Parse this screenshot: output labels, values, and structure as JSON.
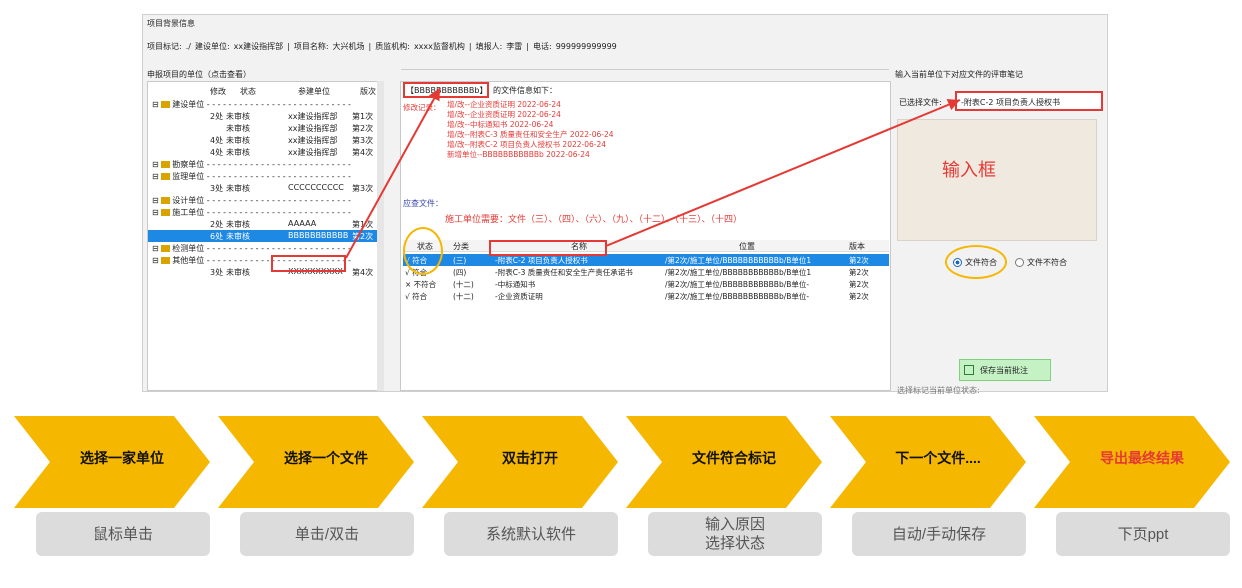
{
  "header": {
    "title": "项目背景信息",
    "info": [
      "项目标记:",
      "./",
      "建设单位:",
      "xx建设指挥部",
      "|",
      "项目名称:",
      "大兴机场",
      "|",
      "质监机构:",
      "xxxx监督机构",
      "|",
      "填报人:",
      "李雷",
      "|",
      "电话:",
      "999999999999"
    ]
  },
  "left_panel": {
    "title": "申报项目的单位（点击查看）",
    "columns": [
      "修改",
      "状态",
      "参建单位",
      "版次"
    ],
    "rows": [
      {
        "type": "group",
        "label": "建设单位"
      },
      {
        "count": "2处",
        "status": "未审核",
        "unit": "xx建设指挥部",
        "ver": "第1次"
      },
      {
        "count": "",
        "status": "未审核",
        "unit": "xx建设指挥部",
        "ver": "第2次"
      },
      {
        "count": "4处",
        "status": "未审核",
        "unit": "xx建设指挥部",
        "ver": "第3次"
      },
      {
        "count": "4处",
        "status": "未审核",
        "unit": "xx建设指挥部",
        "ver": "第4次"
      },
      {
        "type": "group",
        "label": "勘察单位"
      },
      {
        "type": "group",
        "label": "监理单位"
      },
      {
        "count": "3处",
        "status": "未审核",
        "unit": "CCCCCCCCCC",
        "ver": "第3次"
      },
      {
        "type": "group",
        "label": "设计单位"
      },
      {
        "type": "group",
        "label": "施工单位"
      },
      {
        "count": "2处",
        "status": "未审核",
        "unit": "AAAAA",
        "ver": "第1次"
      },
      {
        "count": "6处",
        "status": "未审核",
        "unit": "BBBBBBBBBBB",
        "ver": "第2次",
        "selected": true
      },
      {
        "type": "group",
        "label": "检测单位"
      },
      {
        "type": "group",
        "label": "其他单位"
      },
      {
        "count": "3处",
        "status": "未审核",
        "unit": "XXXXXXXXXX",
        "ver": "第4次"
      }
    ]
  },
  "mid_panel": {
    "unit_tag": "【BBBBBBBBBBBb】",
    "title_suffix": "的文件信息如下：",
    "log_label": "修改记录：",
    "log": [
      "增/改--企业资质证明   2022-06-24",
      "增/改--企业资质证明   2022-06-24",
      "增/改--中标通知书   2022-06-24",
      "增/改--附表C-3 质量责任和安全生产   2022-06-24",
      "增/改--附表C-2 项目负责人授权书   2022-06-24",
      "新增单位--BBBBBBBBBBBb   2022-06-24"
    ],
    "req_label": "应查文件：",
    "req_text": "施工单位需要：文件（三）、（四）、（六）、（九）、（十二）、（十三）、（十四）",
    "grid_columns": [
      "状态",
      "分类",
      "名称",
      "位置",
      "版本"
    ],
    "grid_rows": [
      {
        "state": "√ 符合",
        "cat": "(三)",
        "name": "-附表C-2 项目负责人授权书",
        "loc": "/第2次/施工单位/BBBBBBBBBBBb/B单位1",
        "ver": "第2次",
        "selected": true
      },
      {
        "state": "√ 符合",
        "cat": "(四)",
        "name": "-附表C-3 质量责任和安全生产责任承诺书",
        "loc": "/第2次/施工单位/BBBBBBBBBBBb/B单位1",
        "ver": "第2次"
      },
      {
        "state": "× 不符合",
        "cat": "(十二)",
        "name": "-中标通知书",
        "loc": "/第2次/施工单位/BBBBBBBBBBBb/B单位-",
        "ver": "第2次"
      },
      {
        "state": "√ 符合",
        "cat": "(十二)",
        "name": "-企业资质证明",
        "loc": "/第2次/施工单位/BBBBBBBBBBBb/B单位-",
        "ver": "第2次"
      }
    ]
  },
  "right_panel": {
    "title": "输入当前单位下对应文件的评审笔记",
    "selected_label": "已选择文件:",
    "selected_file": "-附表C-2 项目负责人授权书",
    "input_label": "输入框",
    "radio_ok": "文件符合",
    "radio_bad": "文件不符合",
    "save_label": "保存当前批注",
    "cutoff_text": "选择标记当前单位状态:"
  },
  "steps": [
    {
      "title": "选择一家单位",
      "sub": "鼠标单击"
    },
    {
      "title": "选择一个文件",
      "sub": "单击/双击"
    },
    {
      "title": "双击打开",
      "sub": "系统默认软件"
    },
    {
      "title": "文件符合标记",
      "sub": "输入原因\n选择状态"
    },
    {
      "title": "下一个文件....",
      "sub": "自动/手动保存"
    },
    {
      "title": "导出最终结果",
      "sub": "下页ppt"
    }
  ],
  "colors": {
    "chevron": "#f5b700",
    "highlight_red": "#e53935",
    "select_blue": "#1e88e5"
  }
}
